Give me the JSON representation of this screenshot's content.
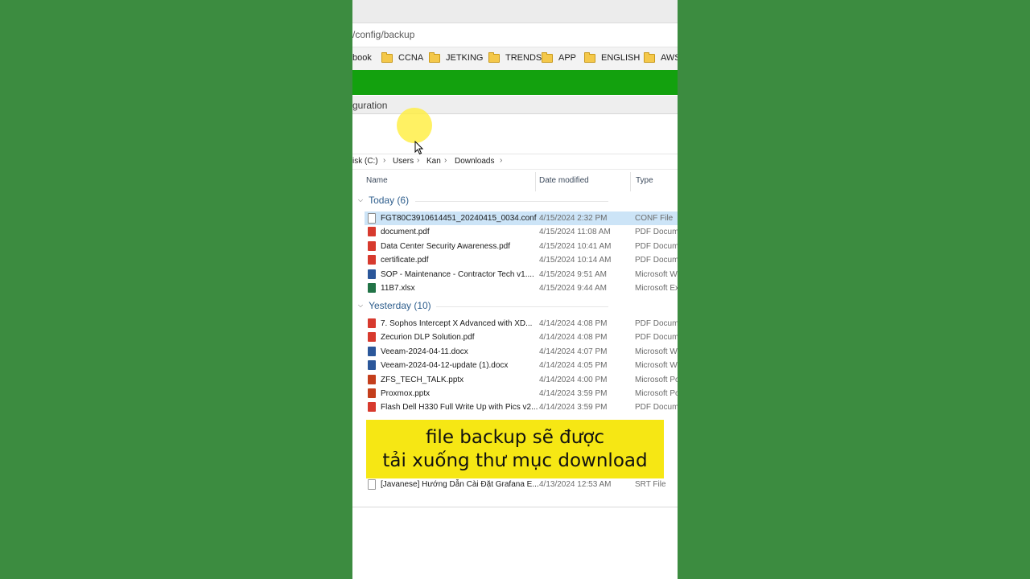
{
  "browser": {
    "url_fragment": "/config/backup",
    "bookmarks": [
      {
        "label": "book",
        "folder": false
      },
      {
        "label": "CCNA",
        "folder": true
      },
      {
        "label": "JETKING",
        "folder": true
      },
      {
        "label": "TRENDS",
        "folder": true
      },
      {
        "label": "APP",
        "folder": true
      },
      {
        "label": "ENGLISH",
        "folder": true
      },
      {
        "label": "AWS",
        "folder": true
      }
    ]
  },
  "page": {
    "header_fragment": "guration",
    "accent_green": "#13a10e"
  },
  "explorer": {
    "breadcrumb": [
      "isk (C:)",
      "Users",
      "Kan",
      "Downloads"
    ],
    "columns": {
      "name": "Name",
      "date": "Date modified",
      "type": "Type"
    },
    "groups": [
      {
        "label": "Today (6)",
        "files": [
          {
            "name": "FGT80C3910614451_20240415_0034.conf",
            "date": "4/15/2024 2:32 PM",
            "type": "CONF File",
            "icon": "conf-file-icon",
            "selected": true
          },
          {
            "name": "document.pdf",
            "date": "4/15/2024 11:08 AM",
            "type": "PDF Docum",
            "icon": "pdf-file-icon"
          },
          {
            "name": "Data Center Security Awareness.pdf",
            "date": "4/15/2024 10:41 AM",
            "type": "PDF Docum",
            "icon": "pdf-file-icon"
          },
          {
            "name": "certificate.pdf",
            "date": "4/15/2024 10:14 AM",
            "type": "PDF Docum",
            "icon": "pdf-file-icon"
          },
          {
            "name": "SOP - Maintenance - Contractor Tech v1....",
            "date": "4/15/2024 9:51 AM",
            "type": "Microsoft W",
            "icon": "word-file-icon"
          },
          {
            "name": "11B7.xlsx",
            "date": "4/15/2024 9:44 AM",
            "type": "Microsoft Ex",
            "icon": "excel-file-icon"
          }
        ]
      },
      {
        "label": "Yesterday (10)",
        "files": [
          {
            "name": "7. Sophos Intercept X Advanced with XD...",
            "date": "4/14/2024 4:08 PM",
            "type": "PDF Docum",
            "icon": "pdf-file-icon"
          },
          {
            "name": "Zecurion DLP Solution.pdf",
            "date": "4/14/2024 4:08 PM",
            "type": "PDF Docum",
            "icon": "pdf-file-icon"
          },
          {
            "name": "Veeam-2024-04-11.docx",
            "date": "4/14/2024 4:07 PM",
            "type": "Microsoft W",
            "icon": "word-file-icon"
          },
          {
            "name": "Veeam-2024-04-12-update (1).docx",
            "date": "4/14/2024 4:05 PM",
            "type": "Microsoft W",
            "icon": "word-file-icon"
          },
          {
            "name": "ZFS_TECH_TALK.pptx",
            "date": "4/14/2024 4:00 PM",
            "type": "Microsoft Po",
            "icon": "powerpoint-file-icon"
          },
          {
            "name": "Proxmox.pptx",
            "date": "4/14/2024 3:59 PM",
            "type": "Microsoft Po",
            "icon": "powerpoint-file-icon"
          },
          {
            "name": "Flash Dell H330 Full Write Up with Pics v2...",
            "date": "4/14/2024 3:59 PM",
            "type": "PDF Docum",
            "icon": "pdf-file-icon"
          }
        ]
      }
    ],
    "last_file": {
      "name": "[Javanese] Hướng Dẫn Cài Đặt Grafana E...",
      "date": "4/13/2024 12:53 AM",
      "type": "SRT File",
      "icon": "srt-file-icon"
    }
  },
  "caption": {
    "line1": "file backup sẽ được",
    "line2": "tải xuống thư mục download",
    "bg": "#f6e714"
  }
}
